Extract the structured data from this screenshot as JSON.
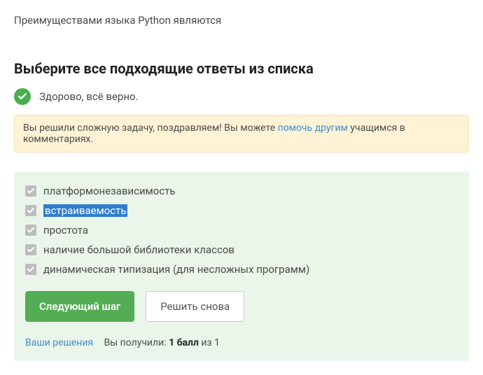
{
  "question": "Преимуществами языка Python являются",
  "instruction": "Выберите все подходящие ответы из списка",
  "feedback": {
    "text": "Здорово, всё верно."
  },
  "congrats": {
    "before": "Вы решили сложную задачу, поздравляем! Вы можете ",
    "link": "помочь другим",
    "after": " учащимся в комментариях."
  },
  "answers": [
    {
      "label": "платформонезависимость",
      "highlighted": false
    },
    {
      "label": "встраиваемость",
      "highlighted": true
    },
    {
      "label": "простота",
      "highlighted": false
    },
    {
      "label": "наличие большой библиотеки классов",
      "highlighted": false
    },
    {
      "label": "динамическая типизация (для несложных программ)",
      "highlighted": false
    }
  ],
  "buttons": {
    "next": "Следующий шаг",
    "retry": "Решить снова"
  },
  "footer": {
    "solutions_link": "Ваши решения",
    "score_prefix": "Вы получили: ",
    "score_value": "1 балл",
    "score_suffix": " из 1"
  }
}
